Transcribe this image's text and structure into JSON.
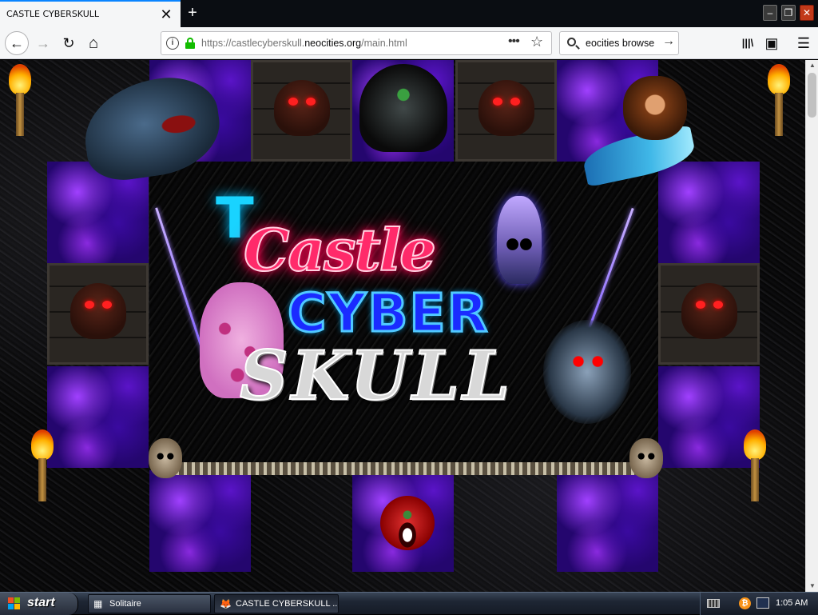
{
  "browser": {
    "tab": {
      "title": "CASTLE CYBERSKULL",
      "close_glyph": "✕"
    },
    "new_tab_glyph": "+",
    "window_buttons": {
      "minimize": "–",
      "restore": "❐",
      "close": "✕"
    },
    "nav": {
      "back_glyph": "←",
      "forward_glyph": "→",
      "reload_glyph": "↻",
      "home_glyph": "⌂"
    },
    "url": {
      "prefix": "https://castlecyberskull.",
      "domain": "neocities.org",
      "suffix": "/main.html",
      "info_glyph": "i",
      "page_actions_glyph": "•••",
      "bookmark_glyph": "☆"
    },
    "search": {
      "value": "eocities browse",
      "go_glyph": "→"
    },
    "toolbar": {
      "library_glyph": "|||\\",
      "sidebar_glyph": "▣",
      "menu_glyph": "☰"
    }
  },
  "page": {
    "logo": {
      "line1": "Castle",
      "line2": "CYBER",
      "line3": "SKULL",
      "bat_glyph": "T"
    },
    "icons": [
      "dragon",
      "reaper",
      "monkey-on-swordfish",
      "blue-skull",
      "pink-leopard",
      "ghost-skull",
      "cacodemon",
      "torch",
      "demon-skull-tile",
      "lightning",
      "bone-spike-bar"
    ],
    "colors": {
      "purple_tile": "#24066e",
      "castle_text": "#ff2a6a",
      "cyber_text": "#1a2bff",
      "skull_text": "#d8d8d8"
    }
  },
  "scrollbar": {
    "up_glyph": "▲",
    "down_glyph": "▼"
  },
  "taskbar": {
    "start_label": "start",
    "tasks": [
      {
        "label": "Solitaire",
        "icon_glyph": "▦"
      },
      {
        "label": "CASTLE CYBERSKULL ...",
        "icon_glyph": "🦊"
      }
    ],
    "tray": {
      "bitcoin_glyph": "₿",
      "clock": "1:05 AM"
    }
  }
}
